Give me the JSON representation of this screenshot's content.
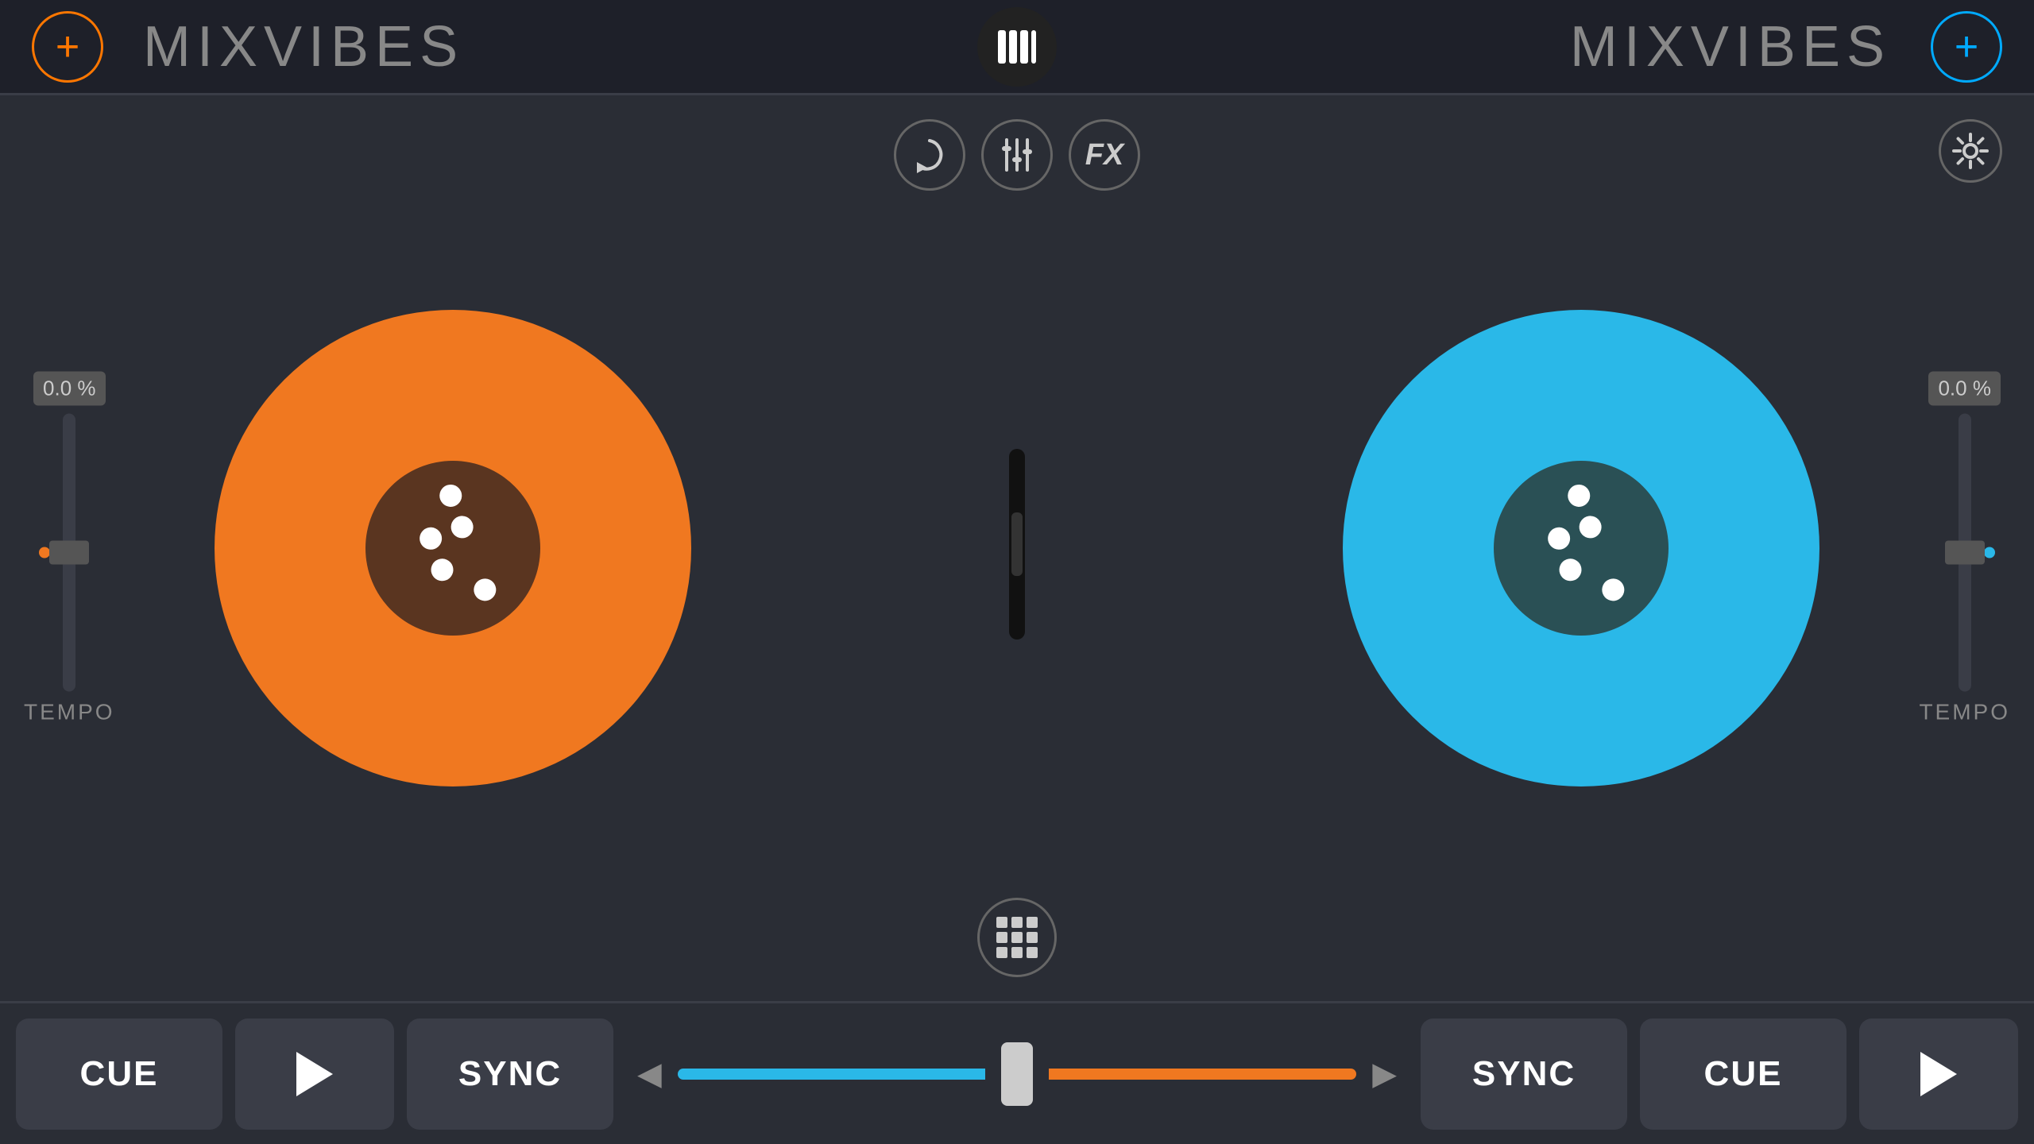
{
  "header": {
    "left_title": "MIXVIBES",
    "right_title": "MIXVIBES",
    "add_left_label": "+",
    "add_right_label": "+",
    "center_bars": "|||"
  },
  "controls": {
    "loop_label": "↻",
    "eq_label": "⚙",
    "fx_label": "FX",
    "grid_label": "grid",
    "settings_label": "⚙"
  },
  "deck_left": {
    "color": "#f07820",
    "center_color": "#5a3520",
    "tempo_label": "TEMPO",
    "tempo_value": "0.0 %"
  },
  "deck_right": {
    "color": "#2ab8e8",
    "center_color": "#2a5055",
    "tempo_label": "TEMPO",
    "tempo_value": "0.0 %"
  },
  "bottom": {
    "left_cue": "CUE",
    "left_sync": "SYNC",
    "right_cue": "CUE",
    "right_sync": "SYNC"
  }
}
